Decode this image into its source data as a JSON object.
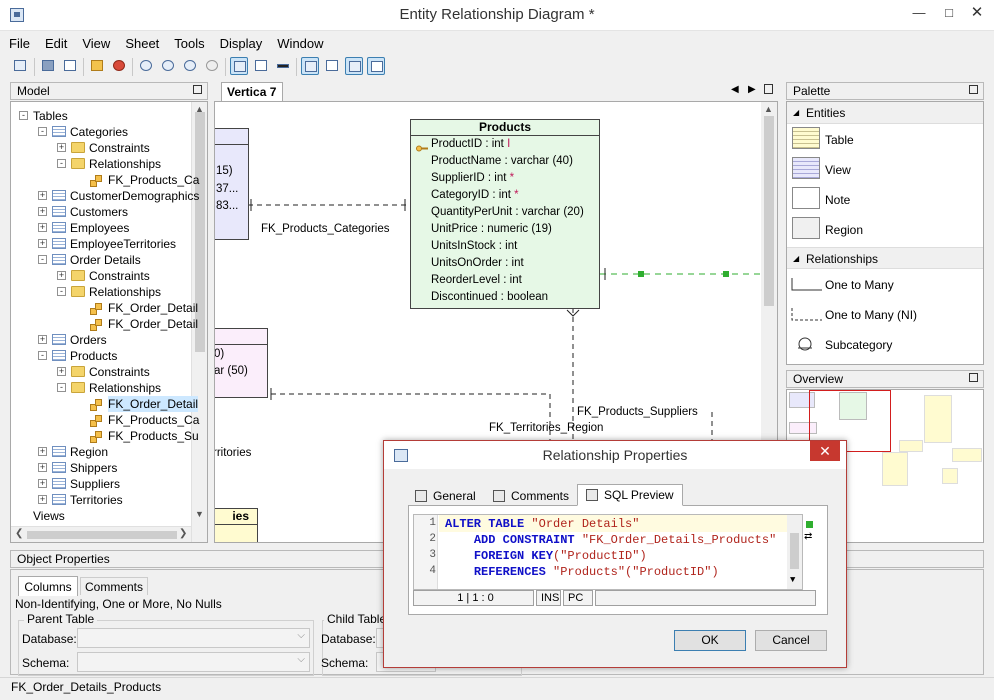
{
  "window": {
    "title": "Entity Relationship Diagram *"
  },
  "menu": [
    "File",
    "Edit",
    "View",
    "Sheet",
    "Tools",
    "Display",
    "Window"
  ],
  "toolbar_icons": [
    "save-icon",
    "print-icon",
    "page-setup-icon",
    "properties-icon",
    "stop-icon",
    "zoom-fit-icon",
    "zoom-in-icon",
    "zoom-out-icon",
    "zoom-reset-icon",
    "display-columns-icon",
    "display-types-icon",
    "display-comments-icon",
    "grid-icon",
    "null-icon",
    "notes-icon",
    "key-icon"
  ],
  "model_panel": {
    "title": "Model",
    "tree": [
      {
        "label": "Tables",
        "level": 0,
        "icon": "none",
        "expander": "minus"
      },
      {
        "label": "Categories",
        "level": 1,
        "icon": "table",
        "expander": "minus"
      },
      {
        "label": "Constraints",
        "level": 2,
        "icon": "folder",
        "expander": "plus"
      },
      {
        "label": "Relationships",
        "level": 2,
        "icon": "folder",
        "expander": "minus"
      },
      {
        "label": "FK_Products_Ca",
        "level": 3,
        "icon": "fk",
        "expander": "none"
      },
      {
        "label": "CustomerDemographics",
        "level": 1,
        "icon": "table",
        "expander": "plus"
      },
      {
        "label": "Customers",
        "level": 1,
        "icon": "table",
        "expander": "plus"
      },
      {
        "label": "Employees",
        "level": 1,
        "icon": "table",
        "expander": "plus"
      },
      {
        "label": "EmployeeTerritories",
        "level": 1,
        "icon": "table",
        "expander": "plus"
      },
      {
        "label": "Order Details",
        "level": 1,
        "icon": "table",
        "expander": "minus"
      },
      {
        "label": "Constraints",
        "level": 2,
        "icon": "folder",
        "expander": "plus"
      },
      {
        "label": "Relationships",
        "level": 2,
        "icon": "folder",
        "expander": "minus"
      },
      {
        "label": "FK_Order_Detail",
        "level": 3,
        "icon": "fk",
        "expander": "none"
      },
      {
        "label": "FK_Order_Detail",
        "level": 3,
        "icon": "fk",
        "expander": "none"
      },
      {
        "label": "Orders",
        "level": 1,
        "icon": "table",
        "expander": "plus"
      },
      {
        "label": "Products",
        "level": 1,
        "icon": "table",
        "expander": "minus"
      },
      {
        "label": "Constraints",
        "level": 2,
        "icon": "folder",
        "expander": "plus"
      },
      {
        "label": "Relationships",
        "level": 2,
        "icon": "folder",
        "expander": "minus"
      },
      {
        "label": "FK_Order_Detail",
        "level": 3,
        "icon": "fk",
        "expander": "none",
        "selected": true
      },
      {
        "label": "FK_Products_Ca",
        "level": 3,
        "icon": "fk",
        "expander": "none"
      },
      {
        "label": "FK_Products_Su",
        "level": 3,
        "icon": "fk",
        "expander": "none"
      },
      {
        "label": "Region",
        "level": 1,
        "icon": "table",
        "expander": "plus"
      },
      {
        "label": "Shippers",
        "level": 1,
        "icon": "table",
        "expander": "plus"
      },
      {
        "label": "Suppliers",
        "level": 1,
        "icon": "table",
        "expander": "plus"
      },
      {
        "label": "Territories",
        "level": 1,
        "icon": "table",
        "expander": "plus"
      },
      {
        "label": "Views",
        "level": 0,
        "icon": "none",
        "expander": "none"
      }
    ]
  },
  "diagram": {
    "tab": "Vertica 7",
    "entity": {
      "name": "Products",
      "attributes": [
        {
          "name": "ProductID",
          "type": "int",
          "marker": "I",
          "pk": true
        },
        {
          "name": "ProductName",
          "type": "varchar (40)",
          "marker": ""
        },
        {
          "name": "SupplierID",
          "type": "int",
          "marker": "*"
        },
        {
          "name": "CategoryID",
          "type": "int",
          "marker": "*"
        },
        {
          "name": "QuantityPerUnit",
          "type": "varchar (20)",
          "marker": ""
        },
        {
          "name": "UnitPrice",
          "type": "numeric (19)",
          "marker": ""
        },
        {
          "name": "UnitsInStock",
          "type": "int",
          "marker": ""
        },
        {
          "name": "UnitsOnOrder",
          "type": "int",
          "marker": ""
        },
        {
          "name": "ReorderLevel",
          "type": "int",
          "marker": ""
        },
        {
          "name": "Discontinued",
          "type": "boolean",
          "marker": ""
        }
      ]
    },
    "partial_left_lines": [
      "15)",
      "37...",
      "83..."
    ],
    "partial_lower_lines": [
      "0)",
      "ar (50)"
    ],
    "partial_bottom_header": "ies",
    "partial_text_territories": "rritories",
    "relationship_labels": [
      "FK_Products_Categories",
      "FK_Products_Suppliers",
      "FK_Territories_Region"
    ]
  },
  "palette": {
    "title": "Palette",
    "entities_section": "Entities",
    "entities": [
      "Table",
      "View",
      "Note",
      "Region"
    ],
    "relationships_section": "Relationships",
    "relationships": [
      "One to Many",
      "One to Many (NI)",
      "Subcategory"
    ]
  },
  "overview": {
    "title": "Overview"
  },
  "object_properties": {
    "title": "Object Properties",
    "tabs": [
      "Columns",
      "Comments"
    ],
    "summary": "Non-Identifying, One or More, No Nulls",
    "parent_table": "Parent Table",
    "child_table": "Child Table",
    "database_label": "Database:",
    "schema_label": "Schema:"
  },
  "dialog": {
    "title": "Relationship Properties",
    "tabs": [
      "General",
      "Comments",
      "SQL Preview"
    ],
    "sql_lines": [
      {
        "n": "1",
        "kw": "ALTER TABLE",
        "rest": " \"Order Details\""
      },
      {
        "n": "2",
        "kw": "ADD CONSTRAINT",
        "rest": " \"FK_Order_Details_Products\""
      },
      {
        "n": "3",
        "kw": "FOREIGN KEY",
        "rest": "(\"ProductID\")"
      },
      {
        "n": "4",
        "kw": "REFERENCES",
        "rest": " \"Products\"(\"ProductID\")"
      }
    ],
    "status": {
      "position": "1 | 1 : 0",
      "ins": "INS",
      "pc": "PC"
    },
    "ok_label": "OK",
    "cancel_label": "Cancel"
  },
  "statusbar": {
    "text": "FK_Order_Details_Products"
  }
}
